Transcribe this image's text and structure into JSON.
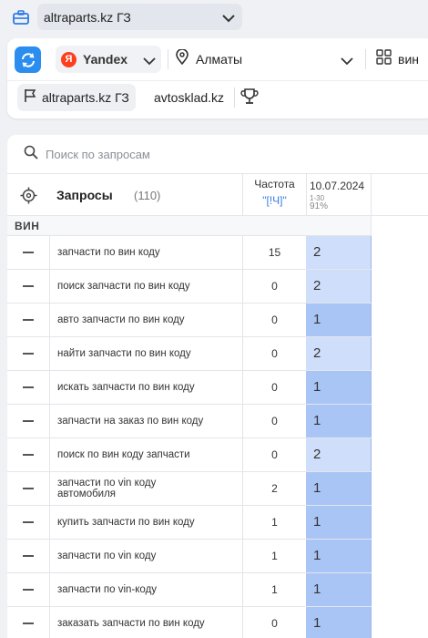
{
  "project": {
    "name": "altraparts.kz ГЗ"
  },
  "toolbar": {
    "engine": "Yandex",
    "engine_logo": "Я",
    "region": "Алматы",
    "group_button": "вин"
  },
  "site_tabs": [
    {
      "label": "altraparts.kz ГЗ",
      "active": true
    },
    {
      "label": "avtosklad.kz",
      "active": false
    }
  ],
  "search": {
    "placeholder": "Поиск по запросам",
    "value": ""
  },
  "table": {
    "queries_header": "Запросы",
    "queries_count": "(110)",
    "freq_header": "Частота",
    "freq_sub": "\"[!Ч]\"",
    "date_header": "10.07.2024",
    "date_range": "1-30",
    "date_percent": "91%",
    "group_name": "ВИН",
    "colors": {
      "pos_top": "#a9c5f5",
      "pos_good": "#cfdffb"
    },
    "rows": [
      {
        "query": "запчасти по вин коду",
        "freq": "15",
        "pos": "2"
      },
      {
        "query": "поиск запчасти по вин коду",
        "freq": "0",
        "pos": "2"
      },
      {
        "query": "авто запчасти по вин коду",
        "freq": "0",
        "pos": "1"
      },
      {
        "query": "найти запчасти по вин коду",
        "freq": "0",
        "pos": "2"
      },
      {
        "query": "искать запчасти по вин коду",
        "freq": "0",
        "pos": "1"
      },
      {
        "query": "запчасти на заказ по вин коду",
        "freq": "0",
        "pos": "1"
      },
      {
        "query": "поиск по вин коду запчасти",
        "freq": "0",
        "pos": "2"
      },
      {
        "query": "запчасти по vin коду автомобиля",
        "freq": "2",
        "pos": "1"
      },
      {
        "query": "купить запчасти по вин коду",
        "freq": "1",
        "pos": "1"
      },
      {
        "query": "запчасти по vin коду",
        "freq": "1",
        "pos": "1"
      },
      {
        "query": "запчасти по vin-коду",
        "freq": "1",
        "pos": "1"
      },
      {
        "query": "заказать запчасти по вин коду",
        "freq": "0",
        "pos": "1"
      }
    ]
  }
}
